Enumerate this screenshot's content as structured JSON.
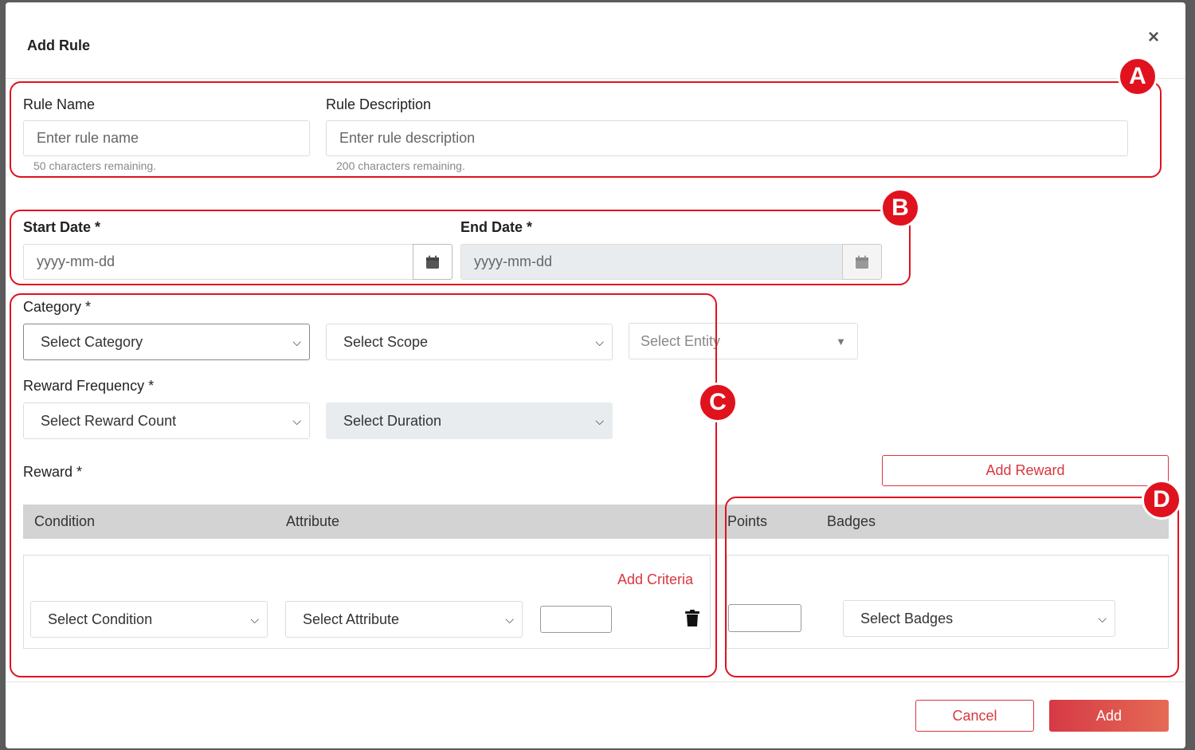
{
  "modal": {
    "title": "Add Rule",
    "close": "×"
  },
  "rule_name": {
    "label": "Rule Name",
    "placeholder": "Enter rule name",
    "hint": "50 characters remaining."
  },
  "rule_description": {
    "label": "Rule Description",
    "placeholder": "Enter rule description",
    "hint": "200 characters remaining."
  },
  "start_date": {
    "label": "Start Date *",
    "placeholder": "yyyy-mm-dd"
  },
  "end_date": {
    "label": "End Date *",
    "placeholder": "yyyy-mm-dd"
  },
  "category": {
    "label": "Category *",
    "select_category": "Select Category",
    "select_scope": "Select Scope",
    "select_entity": "Select Entity"
  },
  "reward_frequency": {
    "label": "Reward Frequency *",
    "select_reward_count": "Select Reward Count",
    "select_duration": "Select Duration"
  },
  "reward": {
    "label": "Reward *",
    "add_reward": "Add Reward",
    "columns": [
      "Condition",
      "Attribute",
      "Points",
      "Badges"
    ],
    "add_criteria": "Add Criteria",
    "select_condition": "Select Condition",
    "select_attribute": "Select Attribute",
    "select_badges": "Select Badges"
  },
  "footer": {
    "cancel": "Cancel",
    "add": "Add"
  },
  "annotations": [
    "A",
    "B",
    "C",
    "D"
  ],
  "colors": {
    "accent": "#d9363e",
    "annotation": "#e0121e",
    "table_header": "#d3d3d3"
  }
}
